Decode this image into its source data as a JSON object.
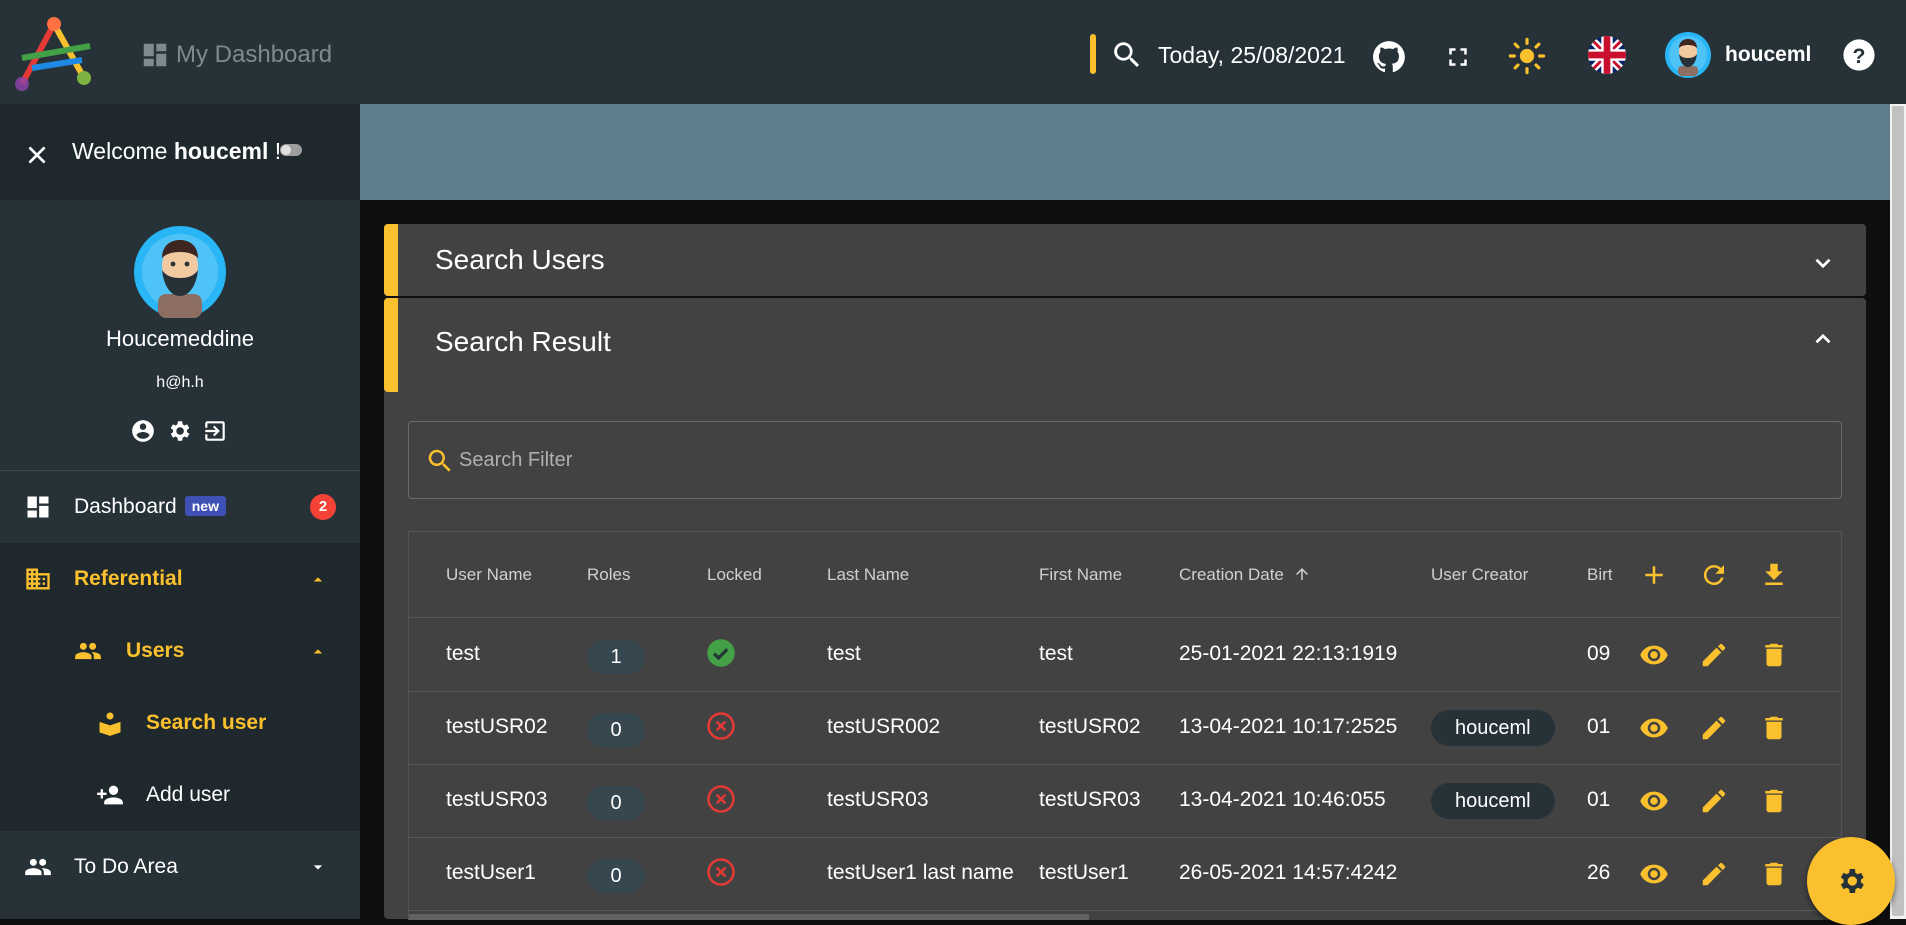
{
  "topbar": {
    "app_title": "My Dashboard",
    "date_text": "Today, 25/08/2021",
    "username": "houceml",
    "icons": [
      "search-icon",
      "github-icon",
      "fullscreen-icon",
      "sun-icon",
      "uk-flag-icon",
      "avatar",
      "help-icon"
    ]
  },
  "sidebar": {
    "welcome_prefix": "Welcome ",
    "welcome_user": "houceml",
    "welcome_suffix": " !",
    "profile_name": "Houcemeddine",
    "profile_email": "h@h.h",
    "items": [
      {
        "label": "Dashboard",
        "badge": "new",
        "count": "2"
      },
      {
        "label": "Referential"
      },
      {
        "label": "Users"
      },
      {
        "label": "Search user"
      },
      {
        "label": "Add user"
      },
      {
        "label": "To Do Area"
      }
    ]
  },
  "panels": {
    "search_users": "Search Users",
    "search_result": "Search Result"
  },
  "filter": {
    "placeholder": "Search Filter"
  },
  "table": {
    "columns": [
      "User Name",
      "Roles",
      "Locked",
      "Last Name",
      "First Name",
      "Creation Date",
      "User Creator",
      "Birt"
    ],
    "rows": [
      {
        "username": "test",
        "roles": "1",
        "locked": true,
        "last_name": "test",
        "first_name": "test",
        "creation_date": "25-01-2021 22:13:1919",
        "creator": "",
        "birth": "09"
      },
      {
        "username": "testUSR02",
        "roles": "0",
        "locked": false,
        "last_name": "testUSR002",
        "first_name": "testUSR02",
        "creation_date": "13-04-2021 10:17:2525",
        "creator": "houceml",
        "birth": "01"
      },
      {
        "username": "testUSR03",
        "roles": "0",
        "locked": false,
        "last_name": "testUSR03",
        "first_name": "testUSR03",
        "creation_date": "13-04-2021 10:46:055",
        "creator": "houceml",
        "birth": "01"
      },
      {
        "username": "testUser1",
        "roles": "0",
        "locked": false,
        "last_name": "testUser1 last name",
        "first_name": "testUser1",
        "creation_date": "26-05-2021 14:57:4242",
        "creator": "",
        "birth": "26"
      }
    ]
  },
  "colors": {
    "accent": "#fbc02d",
    "topbar": "#263238",
    "panel": "#424242",
    "band": "#607d8b",
    "success": "#43a047",
    "error": "#e53935",
    "badge_new": "#3f51b5"
  }
}
